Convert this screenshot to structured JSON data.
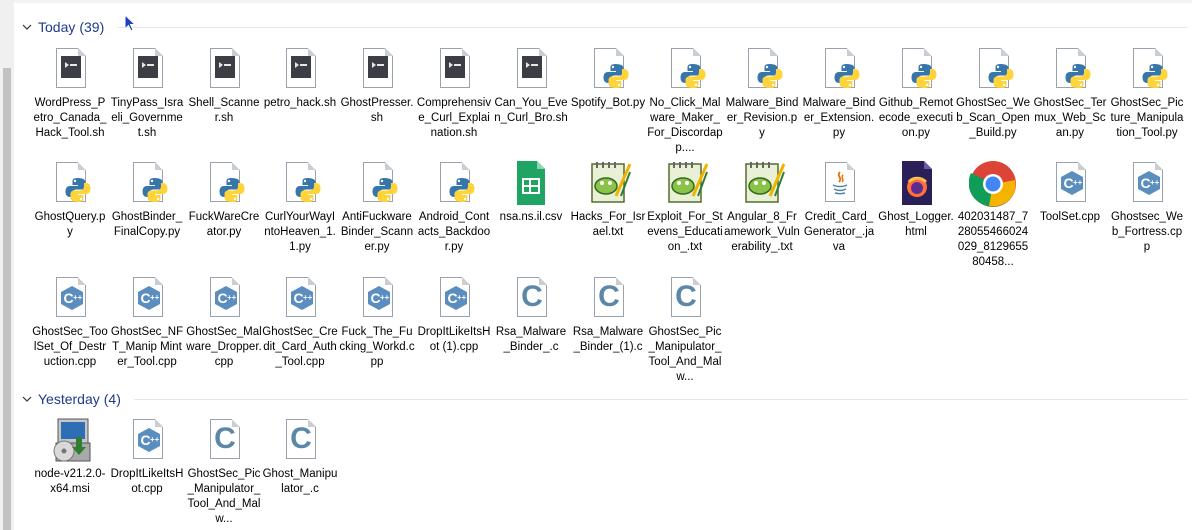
{
  "groups": [
    {
      "title": "Today",
      "count": "(39)",
      "rows": [
        [
          {
            "name": "WordPress_Petro_Canada_Hack_Tool.sh",
            "icon": "shell-script-icon"
          },
          {
            "name": "TinyPass_Israeli_Governmet.sh",
            "icon": "shell-script-icon"
          },
          {
            "name": "Shell_Scanner.sh",
            "icon": "shell-script-icon"
          },
          {
            "name": "petro_hack.sh",
            "icon": "shell-script-icon"
          },
          {
            "name": "GhostPresser.sh",
            "icon": "shell-script-icon"
          },
          {
            "name": "Comprehensive_Curl_Explaination.sh",
            "icon": "shell-script-icon"
          },
          {
            "name": "Can_You_Even_Curl_Bro.sh",
            "icon": "shell-script-icon"
          },
          {
            "name": "Spotify_Bot.py",
            "icon": "python-file-icon"
          },
          {
            "name": "No_Click_Malware_Maker_For_Discordapp....",
            "icon": "python-file-icon"
          },
          {
            "name": "Malware_Binder_Revision.py",
            "icon": "python-file-icon"
          },
          {
            "name": "Malware_Binder_Extension.py",
            "icon": "python-file-icon"
          },
          {
            "name": "Github_Remotecode_execution.py",
            "icon": "python-file-icon"
          },
          {
            "name": "GhostSec_Web_Scan_Open_Build.py",
            "icon": "python-file-icon"
          },
          {
            "name": "GhostSec_Termux_Web_Scan.py",
            "icon": "python-file-icon"
          },
          {
            "name": "GhostSec_Picture_Manipulation_Tool.py",
            "icon": "python-file-icon"
          }
        ],
        [
          {
            "name": "GhostQuery.py",
            "icon": "python-file-icon"
          },
          {
            "name": "GhostBinder_FinalCopy.py",
            "icon": "python-file-icon"
          },
          {
            "name": "FuckWareCreator.py",
            "icon": "python-file-icon"
          },
          {
            "name": "CurlYourWayIntoHeaven_1.1.py",
            "icon": "python-file-icon"
          },
          {
            "name": "AntiFuckwareBinder_Scanner.py",
            "icon": "python-file-icon"
          },
          {
            "name": "Android_Contacts_Backdoor.py",
            "icon": "python-file-icon"
          },
          {
            "name": "nsa.ns.il.csv",
            "icon": "spreadsheet-icon"
          },
          {
            "name": "Hacks_For_Israel.txt",
            "icon": "notepad-plus-plus-icon"
          },
          {
            "name": "Exploit_For_Stevens_Education_.txt",
            "icon": "notepad-plus-plus-icon"
          },
          {
            "name": "Angular_8_Framework_Vulnerability_.txt",
            "icon": "notepad-plus-plus-icon"
          },
          {
            "name": "Credit_Card_Generator_.java",
            "icon": "java-file-icon"
          },
          {
            "name": "Ghost_Logger.html",
            "icon": "firefox-html-icon"
          },
          {
            "name": "402031487_728055466024029_812965580458...",
            "icon": "chrome-file-icon"
          },
          {
            "name": "ToolSet.cpp",
            "icon": "cpp-file-icon"
          },
          {
            "name": "Ghostsec_Web_Fortress.cpp",
            "icon": "cpp-file-icon"
          }
        ],
        [
          {
            "name": "GhostSec_ToolSet_Of_Destruction.cpp",
            "icon": "cpp-file-icon"
          },
          {
            "name": "GhostSec_NFT_Manip Minter_Tool.cpp",
            "icon": "cpp-file-icon"
          },
          {
            "name": "GhostSec_Malware_Dropper.cpp",
            "icon": "cpp-file-icon"
          },
          {
            "name": "GhostSec_Credit_Card_Auth_Tool.cpp",
            "icon": "cpp-file-icon"
          },
          {
            "name": "Fuck_The_Fucking_Workd.cpp",
            "icon": "cpp-file-icon"
          },
          {
            "name": "DropItLikeItsHot (1).cpp",
            "icon": "cpp-file-icon"
          },
          {
            "name": "Rsa_Malware_Binder_.c",
            "icon": "c-file-icon"
          },
          {
            "name": "Rsa_Malware_Binder_(1).c",
            "icon": "c-file-icon"
          },
          {
            "name": "GhostSec_Pic_Manipulator_Tool_And_Malw...",
            "icon": "c-file-icon"
          }
        ]
      ]
    },
    {
      "title": "Yesterday",
      "count": "(4)",
      "rows": [
        [
          {
            "name": "node-v21.2.0-x64.msi",
            "icon": "msi-installer-icon"
          },
          {
            "name": "DropItLikeItsHot.cpp",
            "icon": "cpp-file-icon"
          },
          {
            "name": "GhostSec_Pic_Manipulator_Tool_And_Malw...",
            "icon": "c-file-icon"
          },
          {
            "name": "Ghost_Manipulator_.c",
            "icon": "c-file-icon"
          }
        ]
      ]
    }
  ],
  "colors": {
    "group_title": "#1e3a8a",
    "python_blue": "#3776ab",
    "python_yellow": "#ffd43b",
    "cpp_blue": "#5b8dbf",
    "c_blue": "#5b87a8"
  }
}
